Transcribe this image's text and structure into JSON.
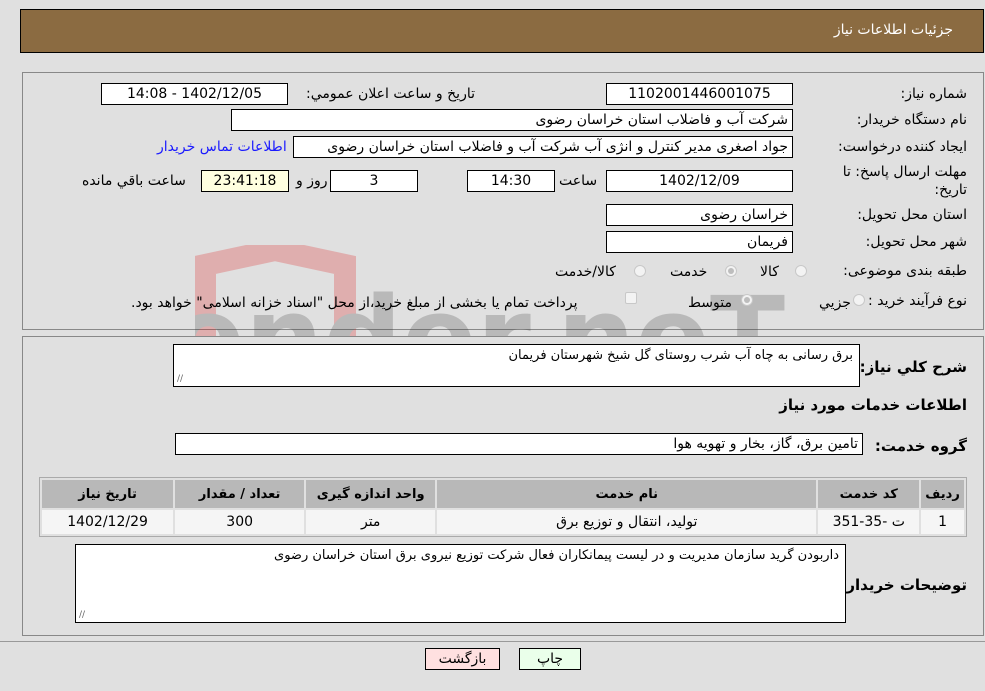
{
  "header": {
    "title": "جزئیات اطلاعات نیاز"
  },
  "form": {
    "need_number": {
      "label": "شماره نیاز:",
      "value": "1102001446001075"
    },
    "announce_datetime": {
      "label": "تاریخ و ساعت اعلان عمومي:",
      "value": "1402/12/05 - 14:08"
    },
    "buyer_org": {
      "label": "نام دستگاه خریدار:",
      "value": "شرکت آب و فاضلاب استان خراسان رضوی"
    },
    "requester": {
      "label": "ایجاد کننده درخواست:",
      "value": "جواد اصغری مدیر کنترل و انژی آب  شرکت آب و فاضلاب استان خراسان رضوی"
    },
    "buyer_contact_link": "اطلاعات تماس خریدار",
    "deadline": {
      "label_line1": "مهلت ارسال پاسخ: تا",
      "label_line2": "تاریخ:",
      "date": "1402/12/09",
      "time_label": "ساعت",
      "time": "14:30",
      "days": "3",
      "days_label": "روز و",
      "remaining": "23:41:18",
      "remaining_label": "ساعت باقي مانده"
    },
    "delivery_province": {
      "label": "استان محل تحویل:",
      "value": "خراسان رضوی"
    },
    "delivery_city": {
      "label": "شهر محل تحویل:",
      "value": "فریمان"
    },
    "category": {
      "label": "طبقه بندی موضوعی:",
      "options": [
        "کالا",
        "خدمت",
        "کالا/خدمت"
      ],
      "selected": "خدمت"
    },
    "purchase_type": {
      "label": "نوع فرآیند خرید :",
      "options": [
        "جزيي",
        "متوسط"
      ],
      "selected": "متوسط",
      "treasury_checkbox_label": "پرداخت تمام یا بخشی از مبلغ خرید،از محل \"اسناد خزانه اسلامی\" خواهد بود.",
      "treasury_checked": false
    }
  },
  "details": {
    "summary_label": "شرح کلي نیاز:",
    "summary_value": "برق رسانی به چاه آب شرب روستای گل شیخ شهرستان فریمان",
    "services_heading": "اطلاعات خدمات مورد نیاز",
    "service_group_label": "گروه خدمت:",
    "service_group_value": "تامین برق، گاز، بخار و تهویه هوا",
    "table": {
      "headers": [
        "ردیف",
        "کد خدمت",
        "نام خدمت",
        "واحد اندازه گیری",
        "تعداد / مقدار",
        "تاریخ نیاز"
      ],
      "rows": [
        [
          "1",
          "ت -35-351",
          "تولید، انتقال و توزیع برق",
          "متر",
          "300",
          "1402/12/29"
        ]
      ]
    },
    "buyer_notes_label": "توضیحات خریدار:",
    "buyer_notes_value": "داربودن گرید سازمان مدیریت  و در لیست پیمانکاران فعال شرکت توزیع نیروی برق استان خراسان رضوی"
  },
  "buttons": {
    "print": "چاپ",
    "back": "بازگشت"
  },
  "watermark": {
    "text": "AriaTender.neT"
  },
  "colors": {
    "header_bg": "#8b6b41",
    "link": "#1a1aff",
    "print_bg": "#eaffea",
    "back_bg": "#ffe0e0",
    "remaining_bg": "#ffffe0"
  }
}
